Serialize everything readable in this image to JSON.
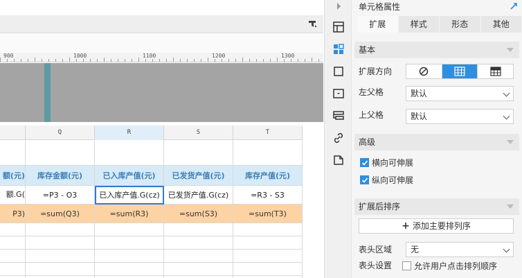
{
  "canvas": {
    "ruler_labels": [
      "900",
      "1000",
      "1100",
      "1200",
      "1300"
    ],
    "columns": [
      "Q",
      "R",
      "S",
      "T"
    ],
    "rows": {
      "header": [
        "额(元)",
        "库存金额(元)",
        "已入库产值(元)",
        "已发货产值(元)",
        "库存产值(元)"
      ],
      "values": [
        "额.G(",
        "=P3 - O3",
        "已入库产值.G(cz)",
        "已发货产值.G(cz)",
        "=R3 - S3"
      ],
      "sums": [
        "P3)",
        "=sum(Q3)",
        "=sum(R3)",
        "=sum(S3)",
        "=sum(T3)"
      ]
    },
    "colors": {
      "header_bg": "#d7eaf7",
      "header_text": "#3d7fb8",
      "sum_bg": "#fed3a4",
      "selection": "#2d7bd6"
    }
  },
  "side_strip": {
    "icons": [
      "collapse-arrow-icon",
      "cell-layout-icon",
      "cell-properties-icon",
      "border-icon",
      "widget-icon",
      "condition-icon",
      "hyperlink-icon",
      "data-icon"
    ]
  },
  "panel": {
    "title": "单元格属性",
    "tabs": [
      "扩展",
      "样式",
      "形态",
      "其他"
    ],
    "basic": {
      "section": "基本",
      "direction_label": "扩展方向",
      "left_parent_label": "左父格",
      "left_parent_value": "默认",
      "top_parent_label": "上父格",
      "top_parent_value": "默认"
    },
    "advanced": {
      "section": "高级",
      "horizontal_label": "横向可伸展",
      "vertical_label": "纵向可伸展"
    },
    "sorting": {
      "section": "扩展后排序",
      "add_label": "添加主要排列序",
      "header_area_label": "表头区域",
      "header_area_value": "无",
      "header_settings_label": "表头设置",
      "allow_sort_label": "允许用户点击排列顺序"
    }
  }
}
